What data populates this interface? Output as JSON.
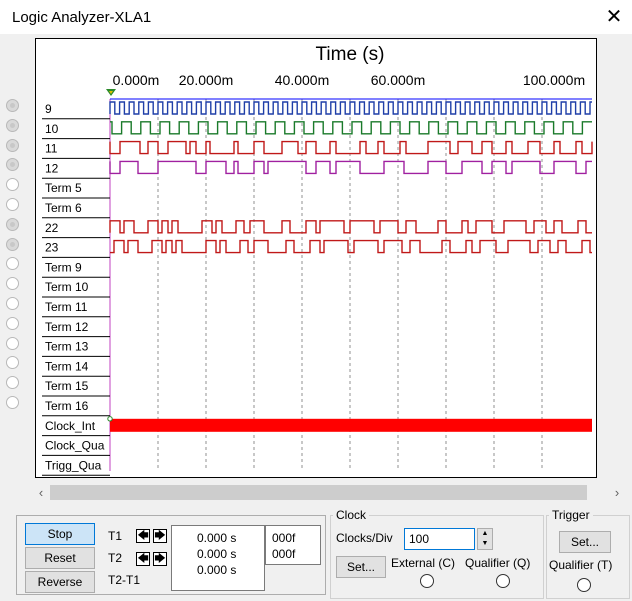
{
  "window": {
    "title": "Logic Analyzer-XLA1",
    "close_glyph": "✕"
  },
  "plot": {
    "title": "Time (s)",
    "time_ticks": [
      "0.000m",
      "20.000m",
      "40.000m",
      "60.000m",
      "100.000m"
    ],
    "channels": [
      {
        "label": "9",
        "color": "#1f3fa8",
        "active": true
      },
      {
        "label": "10",
        "color": "#1a7a2a",
        "active": true
      },
      {
        "label": "11",
        "color": "#c01818",
        "active": true
      },
      {
        "label": "12",
        "color": "#a020a0",
        "active": true
      },
      {
        "label": "Term 5",
        "active": false
      },
      {
        "label": "Term 6",
        "active": false
      },
      {
        "label": "22",
        "color": "#c01818",
        "active": true
      },
      {
        "label": "23",
        "color": "#c01818",
        "active": true
      },
      {
        "label": "Term 9",
        "active": false
      },
      {
        "label": "Term 10",
        "active": false
      },
      {
        "label": "Term 11",
        "active": false
      },
      {
        "label": "Term 12",
        "active": false
      },
      {
        "label": "Term 13",
        "active": false
      },
      {
        "label": "Term 14",
        "active": false
      },
      {
        "label": "Term 15",
        "active": false
      },
      {
        "label": "Term 16",
        "active": false
      }
    ],
    "clock_rows": [
      "Clock_Int",
      "Clock_Qua",
      "Trigg_Qua"
    ],
    "clock_color": "#ff0000",
    "grid_color": "#909090"
  },
  "controls": {
    "stop": "Stop",
    "reset": "Reset",
    "reverse": "Reverse",
    "t1": "T1",
    "t2": "T2",
    "t2t1": "T2-T1",
    "left_arrow": "🡄",
    "right_arrow": "🡆",
    "time_values": [
      "0.000 s",
      "0.000 s",
      "0.000 s"
    ],
    "hex_values": [
      "000f",
      "000f"
    ]
  },
  "clock": {
    "legend": "Clock",
    "clocks_per_div_label": "Clocks/Div",
    "clocks_per_div_value": "100",
    "set_button": "Set...",
    "external_label": "External (C)",
    "qualifier_label": "Qualifier (Q)"
  },
  "trigger": {
    "legend": "Trigger",
    "set_button": "Set...",
    "qualifier_label": "Qualifier (T)"
  },
  "scrollbar": {
    "left_glyph": "‹",
    "right_glyph": "›"
  }
}
